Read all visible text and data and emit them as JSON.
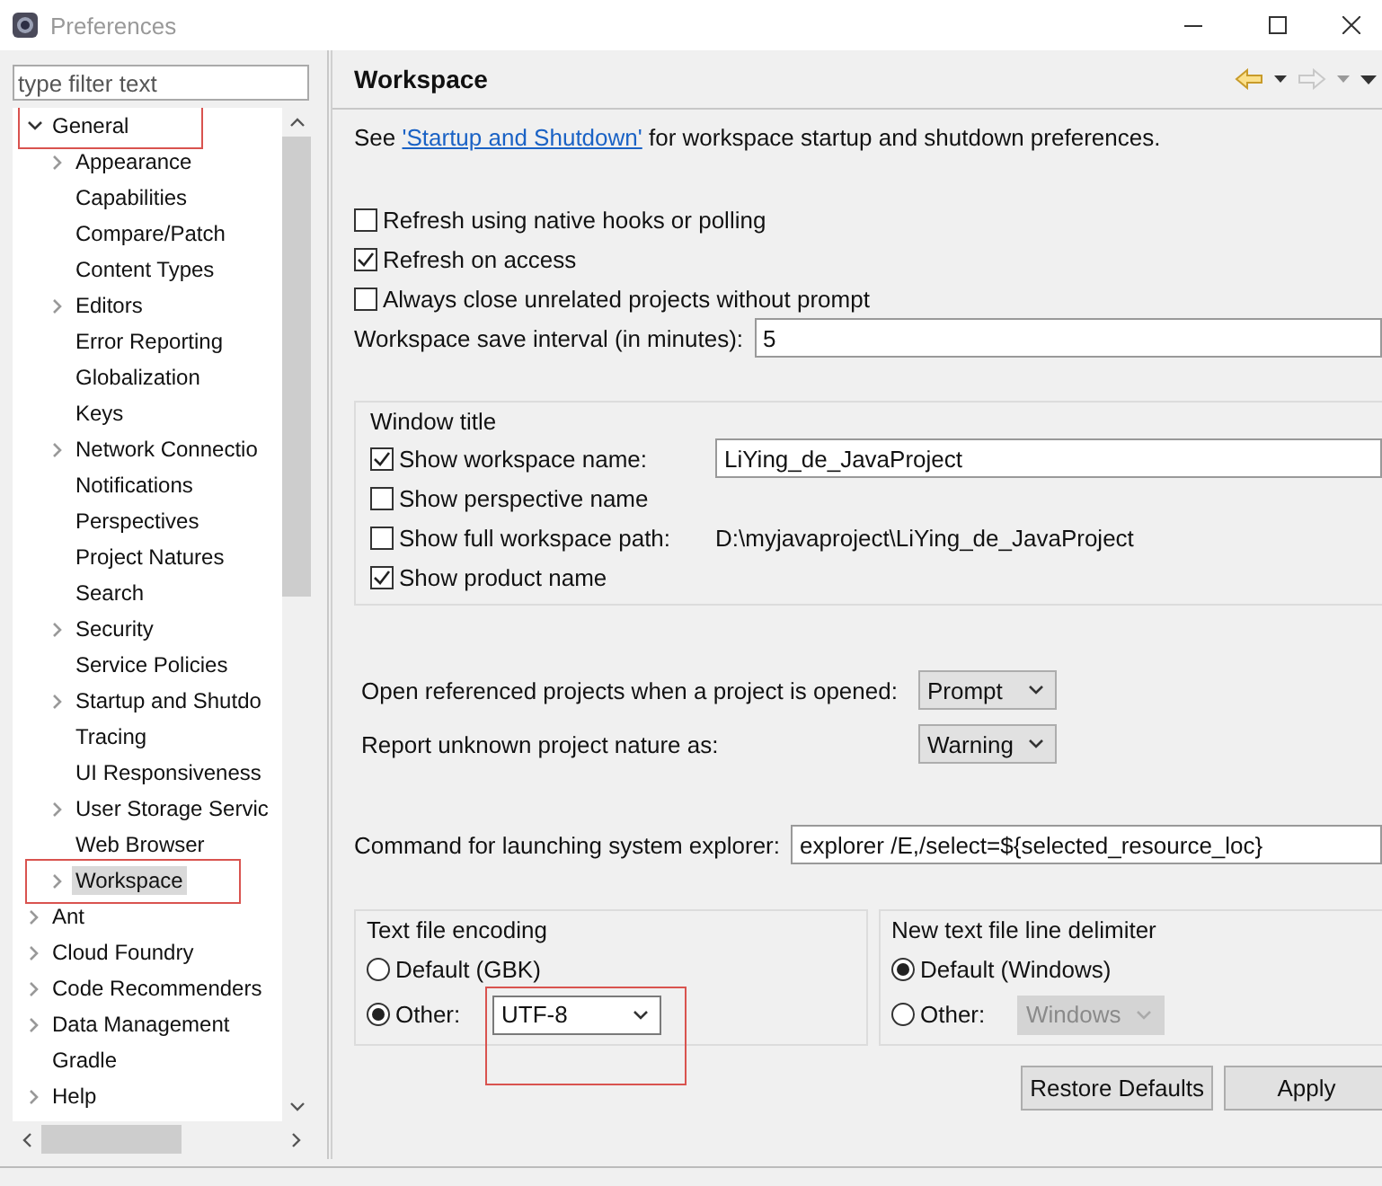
{
  "window": {
    "title": "Preferences"
  },
  "filter": {
    "placeholder": "type filter text"
  },
  "tree": [
    {
      "label": "General",
      "expanded": true,
      "selected": false,
      "annotated": true,
      "children": [
        {
          "label": "Appearance",
          "expanded": false,
          "selected": false,
          "annotated": false
        },
        {
          "label": "Capabilities",
          "selected": false,
          "annotated": false
        },
        {
          "label": "Compare/Patch",
          "selected": false,
          "annotated": false
        },
        {
          "label": "Content Types",
          "selected": false,
          "annotated": false
        },
        {
          "label": "Editors",
          "expanded": false,
          "selected": false,
          "annotated": false
        },
        {
          "label": "Error Reporting",
          "selected": false,
          "annotated": false
        },
        {
          "label": "Globalization",
          "selected": false,
          "annotated": false
        },
        {
          "label": "Keys",
          "selected": false,
          "annotated": false
        },
        {
          "label": "Network Connectio",
          "expanded": false,
          "selected": false,
          "annotated": false
        },
        {
          "label": "Notifications",
          "selected": false,
          "annotated": false
        },
        {
          "label": "Perspectives",
          "selected": false,
          "annotated": false
        },
        {
          "label": "Project Natures",
          "selected": false,
          "annotated": false
        },
        {
          "label": "Search",
          "selected": false,
          "annotated": false
        },
        {
          "label": "Security",
          "expanded": false,
          "selected": false,
          "annotated": false
        },
        {
          "label": "Service Policies",
          "selected": false,
          "annotated": false
        },
        {
          "label": "Startup and Shutdo",
          "expanded": false,
          "selected": false,
          "annotated": false
        },
        {
          "label": "Tracing",
          "selected": false,
          "annotated": false
        },
        {
          "label": "UI Responsiveness",
          "selected": false,
          "annotated": false
        },
        {
          "label": "User Storage Servic",
          "expanded": false,
          "selected": false,
          "annotated": false
        },
        {
          "label": "Web Browser",
          "selected": false,
          "annotated": false
        },
        {
          "label": "Workspace",
          "expanded": false,
          "selected": true,
          "annotated": true
        }
      ]
    },
    {
      "label": "Ant",
      "expanded": false,
      "selected": false,
      "annotated": false
    },
    {
      "label": "Cloud Foundry",
      "expanded": false,
      "selected": false,
      "annotated": false
    },
    {
      "label": "Code Recommenders",
      "expanded": false,
      "selected": false,
      "annotated": false
    },
    {
      "label": "Data Management",
      "expanded": false,
      "selected": false,
      "annotated": false
    },
    {
      "label": "Gradle",
      "selected": false,
      "annotated": false
    },
    {
      "label": "Help",
      "expanded": false,
      "selected": false,
      "annotated": false
    }
  ],
  "page": {
    "title": "Workspace",
    "intro": {
      "before": "See ",
      "link": "'Startup and Shutdown'",
      "after": " for workspace startup and shutdown preferences."
    },
    "options": [
      {
        "kind": "checkbox",
        "label": "Refresh using native hooks or polling",
        "checked": false
      },
      {
        "kind": "checkbox",
        "label": "Refresh on access",
        "checked": true
      },
      {
        "kind": "checkbox",
        "label": "Always close unrelated projects without prompt",
        "checked": false
      },
      {
        "kind": "field",
        "label": "Workspace save interval (in minutes):",
        "value": "5"
      }
    ],
    "window_title": {
      "title": "Window title",
      "options": [
        {
          "kind": "checkbox_field",
          "label": "Show workspace name:",
          "checked": true,
          "value": "LiYing_de_JavaProject"
        },
        {
          "kind": "checkbox",
          "label": "Show perspective name",
          "checked": false
        },
        {
          "kind": "checkbox_path",
          "label": "Show full workspace path:",
          "checked": false,
          "path": "D:\\myjavaproject\\LiYing_de_JavaProject"
        },
        {
          "kind": "checkbox",
          "label": "Show product name",
          "checked": true
        }
      ]
    },
    "combos": [
      {
        "label": "Open referenced projects when a project is opened:",
        "value": "Prompt"
      },
      {
        "label": "Report unknown project nature as:",
        "value": "Warning"
      }
    ],
    "command": {
      "label": "Command for launching system explorer:",
      "value": "explorer /E,/select=${selected_resource_loc}"
    },
    "groups": [
      {
        "title": "Text file encoding",
        "options": [
          {
            "label": "Default (GBK)",
            "selected": false
          },
          {
            "label": "Other:",
            "selected": true,
            "combo": "UTF-8",
            "disabled": false,
            "annotated": true
          }
        ]
      },
      {
        "title": "New text file line delimiter",
        "options": [
          {
            "label": "Default (Windows)",
            "selected": true
          },
          {
            "label": "Other:",
            "selected": false,
            "combo": "Windows",
            "disabled": true,
            "annotated": false
          }
        ]
      }
    ],
    "buttons": [
      {
        "label": "Restore Defaults"
      },
      {
        "label": "Apply"
      }
    ]
  }
}
